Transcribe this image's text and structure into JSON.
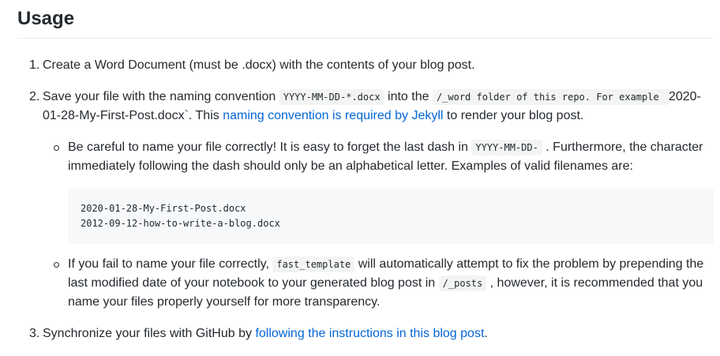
{
  "heading": "Usage",
  "item1": {
    "num": "1.",
    "text": "Create a Word Document (must be .docx) with the contents of your blog post."
  },
  "item2": {
    "num": "2.",
    "t1": "Save your file with the naming convention ",
    "code1": "YYYY-MM-DD-*.docx",
    "t2": " into the ",
    "code2": "/_word folder of this repo. For example ",
    "t3": " 2020-01-28-My-First-Post.docx`. This ",
    "link": "naming convention is required by Jekyll",
    "t4": " to render your blog post."
  },
  "sub1": {
    "t1": "Be careful to name your file correctly! It is easy to forget the last dash in ",
    "code": "YYYY-MM-DD-",
    "t2": " . Furthermore, the character immediately following the dash should only be an alphabetical letter. Examples of valid filenames are:"
  },
  "codeblock": [
    "2020-01-28-My-First-Post.docx",
    "2012-09-12-how-to-write-a-blog.docx"
  ],
  "sub2": {
    "t1": "If you fail to name your file correctly, ",
    "code1": "fast_template",
    "t2": " will automatically attempt to fix the problem by prepending the last modified date of your notebook to your generated blog post in ",
    "code2": "/_posts",
    "t3": " , however, it is recommended that you name your files properly yourself for more transparency."
  },
  "item3": {
    "num": "3.",
    "t1": "Synchronize your files with GitHub by ",
    "link": "following the instructions in this blog post",
    "t2": "."
  },
  "colors": {
    "text": "#24292e",
    "link": "#0366d6",
    "code_bg": "#f6f8fa"
  }
}
